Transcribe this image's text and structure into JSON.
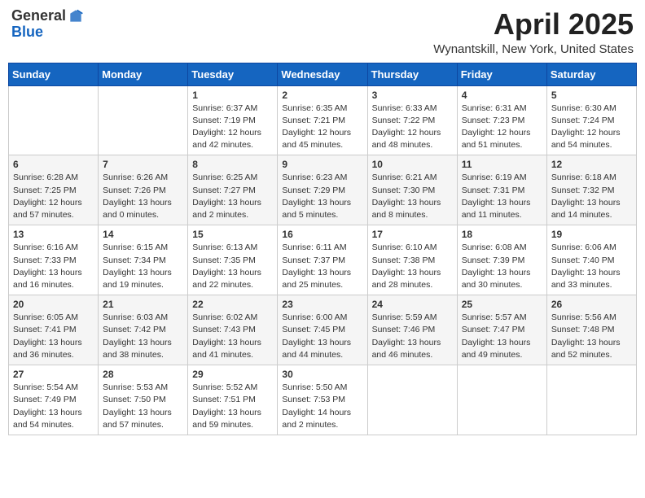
{
  "header": {
    "logo_general": "General",
    "logo_blue": "Blue",
    "month_title": "April 2025",
    "location": "Wynantskill, New York, United States"
  },
  "weekdays": [
    "Sunday",
    "Monday",
    "Tuesday",
    "Wednesday",
    "Thursday",
    "Friday",
    "Saturday"
  ],
  "weeks": [
    [
      {
        "day": "",
        "sunrise": "",
        "sunset": "",
        "daylight": ""
      },
      {
        "day": "",
        "sunrise": "",
        "sunset": "",
        "daylight": ""
      },
      {
        "day": "1",
        "sunrise": "Sunrise: 6:37 AM",
        "sunset": "Sunset: 7:19 PM",
        "daylight": "Daylight: 12 hours and 42 minutes."
      },
      {
        "day": "2",
        "sunrise": "Sunrise: 6:35 AM",
        "sunset": "Sunset: 7:21 PM",
        "daylight": "Daylight: 12 hours and 45 minutes."
      },
      {
        "day": "3",
        "sunrise": "Sunrise: 6:33 AM",
        "sunset": "Sunset: 7:22 PM",
        "daylight": "Daylight: 12 hours and 48 minutes."
      },
      {
        "day": "4",
        "sunrise": "Sunrise: 6:31 AM",
        "sunset": "Sunset: 7:23 PM",
        "daylight": "Daylight: 12 hours and 51 minutes."
      },
      {
        "day": "5",
        "sunrise": "Sunrise: 6:30 AM",
        "sunset": "Sunset: 7:24 PM",
        "daylight": "Daylight: 12 hours and 54 minutes."
      }
    ],
    [
      {
        "day": "6",
        "sunrise": "Sunrise: 6:28 AM",
        "sunset": "Sunset: 7:25 PM",
        "daylight": "Daylight: 12 hours and 57 minutes."
      },
      {
        "day": "7",
        "sunrise": "Sunrise: 6:26 AM",
        "sunset": "Sunset: 7:26 PM",
        "daylight": "Daylight: 13 hours and 0 minutes."
      },
      {
        "day": "8",
        "sunrise": "Sunrise: 6:25 AM",
        "sunset": "Sunset: 7:27 PM",
        "daylight": "Daylight: 13 hours and 2 minutes."
      },
      {
        "day": "9",
        "sunrise": "Sunrise: 6:23 AM",
        "sunset": "Sunset: 7:29 PM",
        "daylight": "Daylight: 13 hours and 5 minutes."
      },
      {
        "day": "10",
        "sunrise": "Sunrise: 6:21 AM",
        "sunset": "Sunset: 7:30 PM",
        "daylight": "Daylight: 13 hours and 8 minutes."
      },
      {
        "day": "11",
        "sunrise": "Sunrise: 6:19 AM",
        "sunset": "Sunset: 7:31 PM",
        "daylight": "Daylight: 13 hours and 11 minutes."
      },
      {
        "day": "12",
        "sunrise": "Sunrise: 6:18 AM",
        "sunset": "Sunset: 7:32 PM",
        "daylight": "Daylight: 13 hours and 14 minutes."
      }
    ],
    [
      {
        "day": "13",
        "sunrise": "Sunrise: 6:16 AM",
        "sunset": "Sunset: 7:33 PM",
        "daylight": "Daylight: 13 hours and 16 minutes."
      },
      {
        "day": "14",
        "sunrise": "Sunrise: 6:15 AM",
        "sunset": "Sunset: 7:34 PM",
        "daylight": "Daylight: 13 hours and 19 minutes."
      },
      {
        "day": "15",
        "sunrise": "Sunrise: 6:13 AM",
        "sunset": "Sunset: 7:35 PM",
        "daylight": "Daylight: 13 hours and 22 minutes."
      },
      {
        "day": "16",
        "sunrise": "Sunrise: 6:11 AM",
        "sunset": "Sunset: 7:37 PM",
        "daylight": "Daylight: 13 hours and 25 minutes."
      },
      {
        "day": "17",
        "sunrise": "Sunrise: 6:10 AM",
        "sunset": "Sunset: 7:38 PM",
        "daylight": "Daylight: 13 hours and 28 minutes."
      },
      {
        "day": "18",
        "sunrise": "Sunrise: 6:08 AM",
        "sunset": "Sunset: 7:39 PM",
        "daylight": "Daylight: 13 hours and 30 minutes."
      },
      {
        "day": "19",
        "sunrise": "Sunrise: 6:06 AM",
        "sunset": "Sunset: 7:40 PM",
        "daylight": "Daylight: 13 hours and 33 minutes."
      }
    ],
    [
      {
        "day": "20",
        "sunrise": "Sunrise: 6:05 AM",
        "sunset": "Sunset: 7:41 PM",
        "daylight": "Daylight: 13 hours and 36 minutes."
      },
      {
        "day": "21",
        "sunrise": "Sunrise: 6:03 AM",
        "sunset": "Sunset: 7:42 PM",
        "daylight": "Daylight: 13 hours and 38 minutes."
      },
      {
        "day": "22",
        "sunrise": "Sunrise: 6:02 AM",
        "sunset": "Sunset: 7:43 PM",
        "daylight": "Daylight: 13 hours and 41 minutes."
      },
      {
        "day": "23",
        "sunrise": "Sunrise: 6:00 AM",
        "sunset": "Sunset: 7:45 PM",
        "daylight": "Daylight: 13 hours and 44 minutes."
      },
      {
        "day": "24",
        "sunrise": "Sunrise: 5:59 AM",
        "sunset": "Sunset: 7:46 PM",
        "daylight": "Daylight: 13 hours and 46 minutes."
      },
      {
        "day": "25",
        "sunrise": "Sunrise: 5:57 AM",
        "sunset": "Sunset: 7:47 PM",
        "daylight": "Daylight: 13 hours and 49 minutes."
      },
      {
        "day": "26",
        "sunrise": "Sunrise: 5:56 AM",
        "sunset": "Sunset: 7:48 PM",
        "daylight": "Daylight: 13 hours and 52 minutes."
      }
    ],
    [
      {
        "day": "27",
        "sunrise": "Sunrise: 5:54 AM",
        "sunset": "Sunset: 7:49 PM",
        "daylight": "Daylight: 13 hours and 54 minutes."
      },
      {
        "day": "28",
        "sunrise": "Sunrise: 5:53 AM",
        "sunset": "Sunset: 7:50 PM",
        "daylight": "Daylight: 13 hours and 57 minutes."
      },
      {
        "day": "29",
        "sunrise": "Sunrise: 5:52 AM",
        "sunset": "Sunset: 7:51 PM",
        "daylight": "Daylight: 13 hours and 59 minutes."
      },
      {
        "day": "30",
        "sunrise": "Sunrise: 5:50 AM",
        "sunset": "Sunset: 7:53 PM",
        "daylight": "Daylight: 14 hours and 2 minutes."
      },
      {
        "day": "",
        "sunrise": "",
        "sunset": "",
        "daylight": ""
      },
      {
        "day": "",
        "sunrise": "",
        "sunset": "",
        "daylight": ""
      },
      {
        "day": "",
        "sunrise": "",
        "sunset": "",
        "daylight": ""
      }
    ]
  ]
}
